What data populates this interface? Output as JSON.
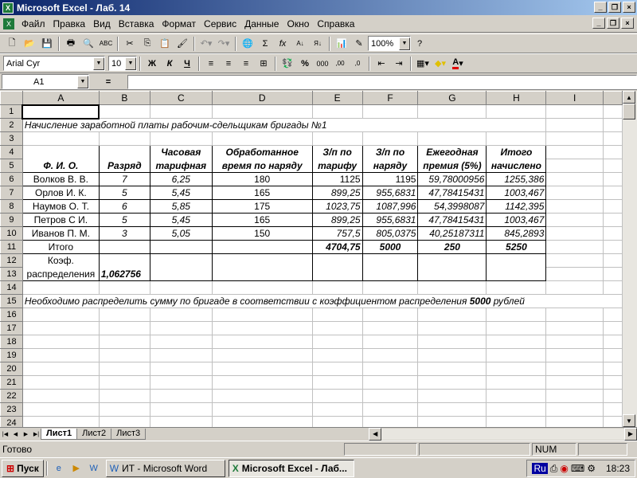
{
  "window": {
    "title": "Microsoft Excel - Лаб. 14",
    "app_icon": "X"
  },
  "menu": [
    "Файл",
    "Правка",
    "Вид",
    "Вставка",
    "Формат",
    "Сервис",
    "Данные",
    "Окно",
    "Справка"
  ],
  "toolbar": {
    "zoom": "100%"
  },
  "format": {
    "font": "Arial Cyr",
    "size": "10",
    "bold": "Ж",
    "italic": "К",
    "underline": "Ч",
    "percent": "%",
    "thousands": "000",
    "font_color_label": "A"
  },
  "formula": {
    "name_box": "A1",
    "eq": "="
  },
  "columns": [
    "A",
    "B",
    "C",
    "D",
    "E",
    "F",
    "G",
    "H",
    "I"
  ],
  "rows": [
    "1",
    "2",
    "3",
    "4",
    "5",
    "6",
    "7",
    "8",
    "9",
    "10",
    "11",
    "12",
    "13",
    "14",
    "15",
    "16",
    "17",
    "18",
    "19",
    "20",
    "21",
    "22",
    "23",
    "24"
  ],
  "sheet": {
    "title_row2": "Начисление заработной платы рабочим-сдельщикам бригады №1",
    "headers": {
      "a": "Ф. И. О.",
      "b": "Разряд",
      "c1": "Часовая",
      "c2": "тарифная",
      "d1": "Обработанное",
      "d2": "время по наряду",
      "e1": "З/п по",
      "e2": "тарифу",
      "f1": "З/п по",
      "f2": "наряду",
      "g1": "Ежегодная",
      "g2": "премия (5%)",
      "h1": "Итого",
      "h2": "начислено"
    },
    "data": [
      {
        "name": "Волков В. В.",
        "grade": "7",
        "rate": "6,25",
        "hours": "180",
        "tariff": "1125",
        "order": "1195",
        "bonus": "59,78000956",
        "total": "1255,386"
      },
      {
        "name": "Орлов И. К.",
        "grade": "5",
        "rate": "5,45",
        "hours": "165",
        "tariff": "899,25",
        "order": "955,6831",
        "bonus": "47,78415431",
        "total": "1003,467"
      },
      {
        "name": "Наумов О. Т.",
        "grade": "6",
        "rate": "5,85",
        "hours": "175",
        "tariff": "1023,75",
        "order": "1087,996",
        "bonus": "54,3998087",
        "total": "1142,395"
      },
      {
        "name": "Петров С И.",
        "grade": "5",
        "rate": "5,45",
        "hours": "165",
        "tariff": "899,25",
        "order": "955,6831",
        "bonus": "47,78415431",
        "total": "1003,467"
      },
      {
        "name": "Иванов П. М.",
        "grade": "3",
        "rate": "5,05",
        "hours": "150",
        "tariff": "757,5",
        "order": "805,0375",
        "bonus": "40,25187311",
        "total": "845,2893"
      }
    ],
    "totals": {
      "label": "Итого",
      "tariff": "4704,75",
      "order": "5000",
      "bonus": "250",
      "total": "5250"
    },
    "coef": {
      "label1": "Коэф.",
      "label2": "распределения",
      "value": "1,062756"
    },
    "note": {
      "text": "Необходимо распределить сумму по бригаде в соответствии с коэффициентом распределения",
      "amount": "5000",
      "unit": "рублей"
    }
  },
  "tabs": [
    "Лист1",
    "Лист2",
    "Лист3"
  ],
  "status": {
    "ready": "Готово",
    "num": "NUM"
  },
  "taskbar": {
    "start": "Пуск",
    "items": [
      "ИТ - Microsoft Word",
      "Microsoft Excel - Лаб..."
    ],
    "lang": "Ru",
    "time": "18:23"
  }
}
